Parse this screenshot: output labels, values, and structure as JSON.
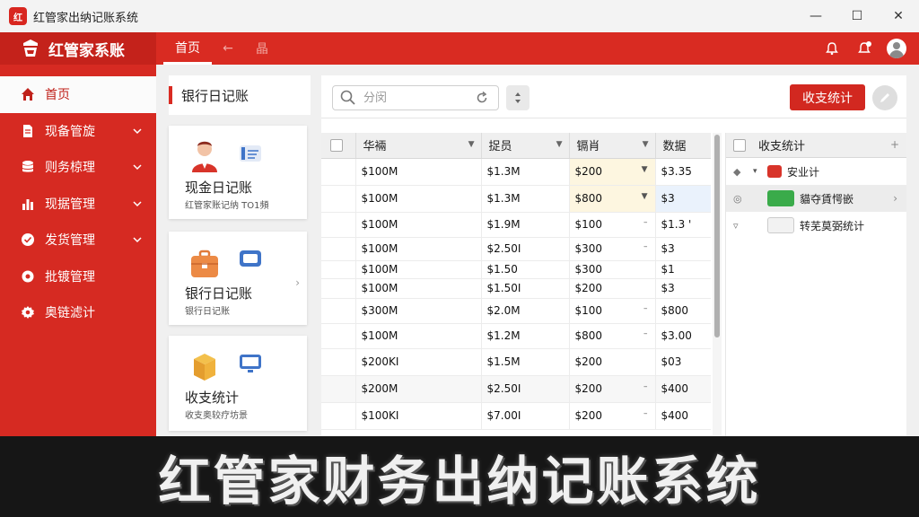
{
  "window": {
    "title": "红管家出纳记账系统",
    "logo": "红",
    "minimize": "—",
    "maximize": "☐",
    "close": "✕"
  },
  "header": {
    "brand": "红管家系账",
    "tabs": [
      {
        "label": "首页"
      },
      {
        "label": "←"
      },
      {
        "label": "晶"
      }
    ],
    "icons": [
      "bell-icon",
      "notification-icon",
      "avatar"
    ]
  },
  "sidebar": {
    "items": [
      {
        "label": "首页",
        "icon": "home-icon",
        "active": true
      },
      {
        "label": "现备管旋",
        "icon": "document-icon",
        "chevron": true
      },
      {
        "label": "则务椋理",
        "icon": "database-icon",
        "chevron": true
      },
      {
        "label": "现据管理",
        "icon": "chart-icon",
        "chevron": true
      },
      {
        "label": "发货管理",
        "icon": "check-icon",
        "chevron": true
      },
      {
        "label": "批镀管理",
        "icon": "gear-icon"
      },
      {
        "label": "奥链滤计",
        "icon": "settings-icon"
      }
    ]
  },
  "left_panel": {
    "title": "银行日记账",
    "cards": [
      {
        "title": "现金日记账",
        "subtitle": "红管家账记纳 TO1頻",
        "icon": "person-icon"
      },
      {
        "title": "银行日记账",
        "subtitle": "银行日记账",
        "icon": "briefcase-icon"
      },
      {
        "title": "收支统计",
        "subtitle": "收支奥较疗坊景",
        "icon": "box-icon"
      }
    ]
  },
  "toolbar": {
    "search_placeholder": "分闵",
    "stat_button": "收支统计"
  },
  "table": {
    "columns": [
      "华裲",
      "捉员",
      "镉肖",
      "数据"
    ],
    "rows": [
      [
        "$100M",
        "$1.3M",
        "$200",
        "$3.35"
      ],
      [
        "$100M",
        "$1.3M",
        "$800",
        "$3"
      ],
      [
        "$100M",
        "$1.9M",
        "$100",
        "$1.3 '"
      ],
      [
        "$100M",
        "$2.50I",
        "$300",
        "$3"
      ],
      [
        "$100M",
        "$1.50",
        "$300",
        "$1"
      ],
      [
        "$100M",
        "$1.50I",
        "$200",
        "$3"
      ],
      [
        "$300M",
        "$2.0M",
        "$100",
        "$800"
      ],
      [
        "$100M",
        "$1.2M",
        "$800",
        "$3.00"
      ],
      [
        "$200KI",
        "$1.5M",
        "$200",
        "$03"
      ],
      [
        "$200M",
        "$2.50I",
        "$200",
        "$400"
      ],
      [
        "$100KI",
        "$7.00I",
        "$200",
        "$400"
      ]
    ]
  },
  "right_panel": {
    "header": "收支统计",
    "items": [
      {
        "label": "安业计"
      },
      {
        "label": "貓夺賃愕嵌"
      },
      {
        "label": "转芜莫弼统计"
      }
    ]
  },
  "banner": {
    "text": "红管家财务出纳记账系统"
  },
  "colors": {
    "brand_red": "#d92b22",
    "dark_red": "#c4221b",
    "green": "#3aab4a"
  }
}
